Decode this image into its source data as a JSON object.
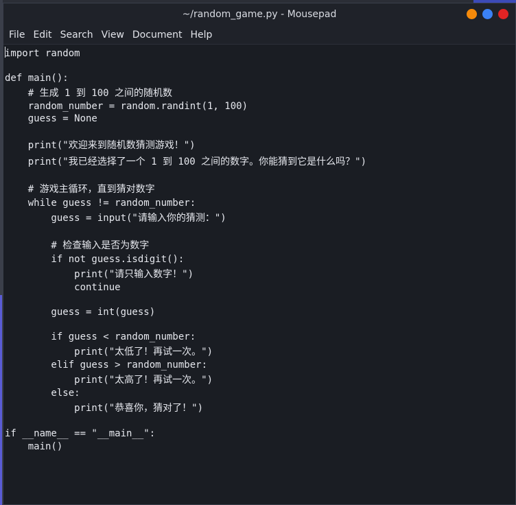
{
  "window": {
    "title": "~/random_game.py - Mousepad",
    "controls": [
      {
        "name": "minimize",
        "color": "#f58a0a"
      },
      {
        "name": "maximize",
        "color": "#3b82f6"
      },
      {
        "name": "close",
        "color": "#e02424"
      }
    ]
  },
  "menu": {
    "file": "File",
    "edit": "Edit",
    "search": "Search",
    "view": "View",
    "document": "Document",
    "help": "Help"
  },
  "editor": {
    "lines": [
      "import random",
      "",
      "def main():",
      "    # 生成 1 到 100 之间的随机数",
      "    random_number = random.randint(1, 100)",
      "    guess = None",
      "",
      "    print(\"欢迎来到随机数猜测游戏！\")",
      "    print(\"我已经选择了一个 1 到 100 之间的数字。你能猜到它是什么吗？\")",
      "",
      "    # 游戏主循环，直到猜对数字",
      "    while guess != random_number:",
      "        guess = input(\"请输入你的猜测：\")",
      "",
      "        # 检查输入是否为数字",
      "        if not guess.isdigit():",
      "            print(\"请只输入数字！\")",
      "            continue",
      "",
      "        guess = int(guess)",
      "",
      "        if guess < random_number:",
      "            print(\"太低了！再试一次。\")",
      "        elif guess > random_number:",
      "            print(\"太高了！再试一次。\")",
      "        else:",
      "            print(\"恭喜你，猜对了！\")",
      "",
      "if __name__ == \"__main__\":",
      "    main()"
    ]
  }
}
